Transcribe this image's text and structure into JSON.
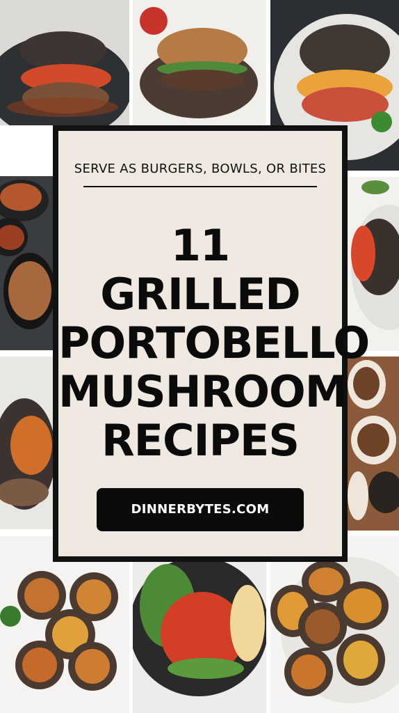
{
  "card": {
    "subtitle": "SERVE AS BURGERS, BOWLS, OR BITES",
    "title_lines": [
      "11",
      "GRILLED",
      "PORTOBELLO",
      "MUSHROOM",
      "RECIPES"
    ],
    "website": "DINNERBYTES.COM"
  },
  "colors": {
    "card_background": "#efe9e2",
    "card_border": "#111111",
    "button_background": "#0b0b0b",
    "button_text": "#ffffff",
    "title_text": "#0b0b0b"
  },
  "photos": [
    "portobello-burger-tomato-photo",
    "portobello-burger-photo",
    "portobello-cheese-burger-photo",
    "stuffed-portobello-pan-photo",
    "stuffed-portobello-close-photo",
    "grilled-portobello-tomato-photo",
    "stuffed-mushroom-bites-photo",
    "stuffed-mushroom-caps-photo",
    "portobello-bowl-photo",
    "stuffed-mushroom-platter-photo"
  ]
}
